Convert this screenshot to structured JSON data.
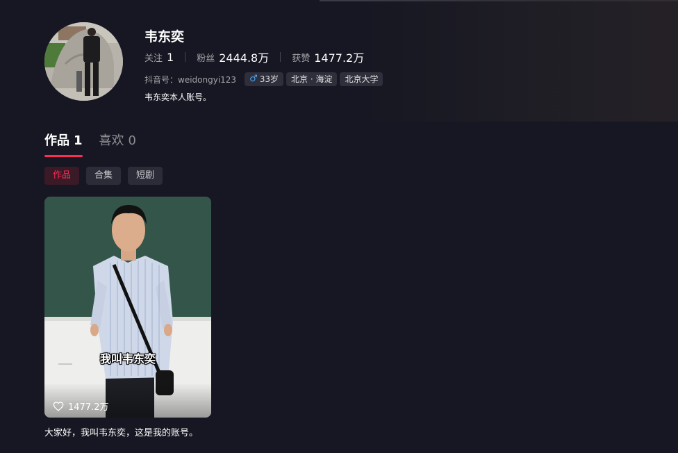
{
  "profile": {
    "name": "韦东奕",
    "following_label": "关注",
    "following_value": "1",
    "fans_label": "粉丝",
    "fans_value": "2444.8万",
    "likes_label": "获赞",
    "likes_value": "1477.2万",
    "account_id": "抖音号：weidongyi123",
    "tags": {
      "gender_icon": "male-icon",
      "age": "33岁",
      "location": "北京 · 海淀",
      "school": "北京大学"
    },
    "bio": "韦东奕本人账号。"
  },
  "tabs": [
    {
      "label": "作品",
      "count": "1",
      "active": true
    },
    {
      "label": "喜欢",
      "count": "0",
      "active": false
    }
  ],
  "subtabs": [
    {
      "label": "作品",
      "active": true
    },
    {
      "label": "合集",
      "active": false
    },
    {
      "label": "短剧",
      "active": false
    }
  ],
  "videos": [
    {
      "overlay_text": "我叫韦东奕",
      "likes_icon": "heart-icon",
      "likes": "1477.2万",
      "title": "大家好，我叫韦东奕，这是我的账号。"
    }
  ],
  "colors": {
    "background": "#161722",
    "accent": "#fe2c55",
    "chip_bg": "#2b2c38",
    "male_blue": "#4aa8ff"
  }
}
